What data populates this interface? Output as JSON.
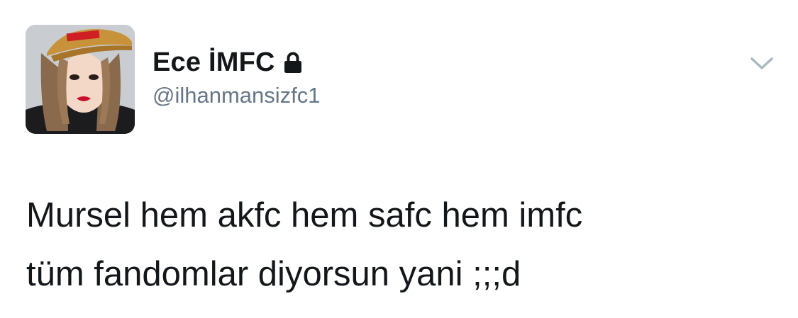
{
  "author": {
    "display_name": "Ece İMFC",
    "handle": "@ilhanmansizfc1",
    "protected": true,
    "avatar_cap_text": "Supreme"
  },
  "tweet": {
    "lines": [
      "Mursel hem akfc hem safc hem imfc",
      "tüm fandomlar diyorsun yani ;;;d"
    ]
  },
  "icons": {
    "lock": "lock-icon",
    "menu": "chevron-down-icon"
  },
  "colors": {
    "text": "#14171a",
    "secondary_text": "#657786",
    "chevron": "#aab8c2"
  }
}
